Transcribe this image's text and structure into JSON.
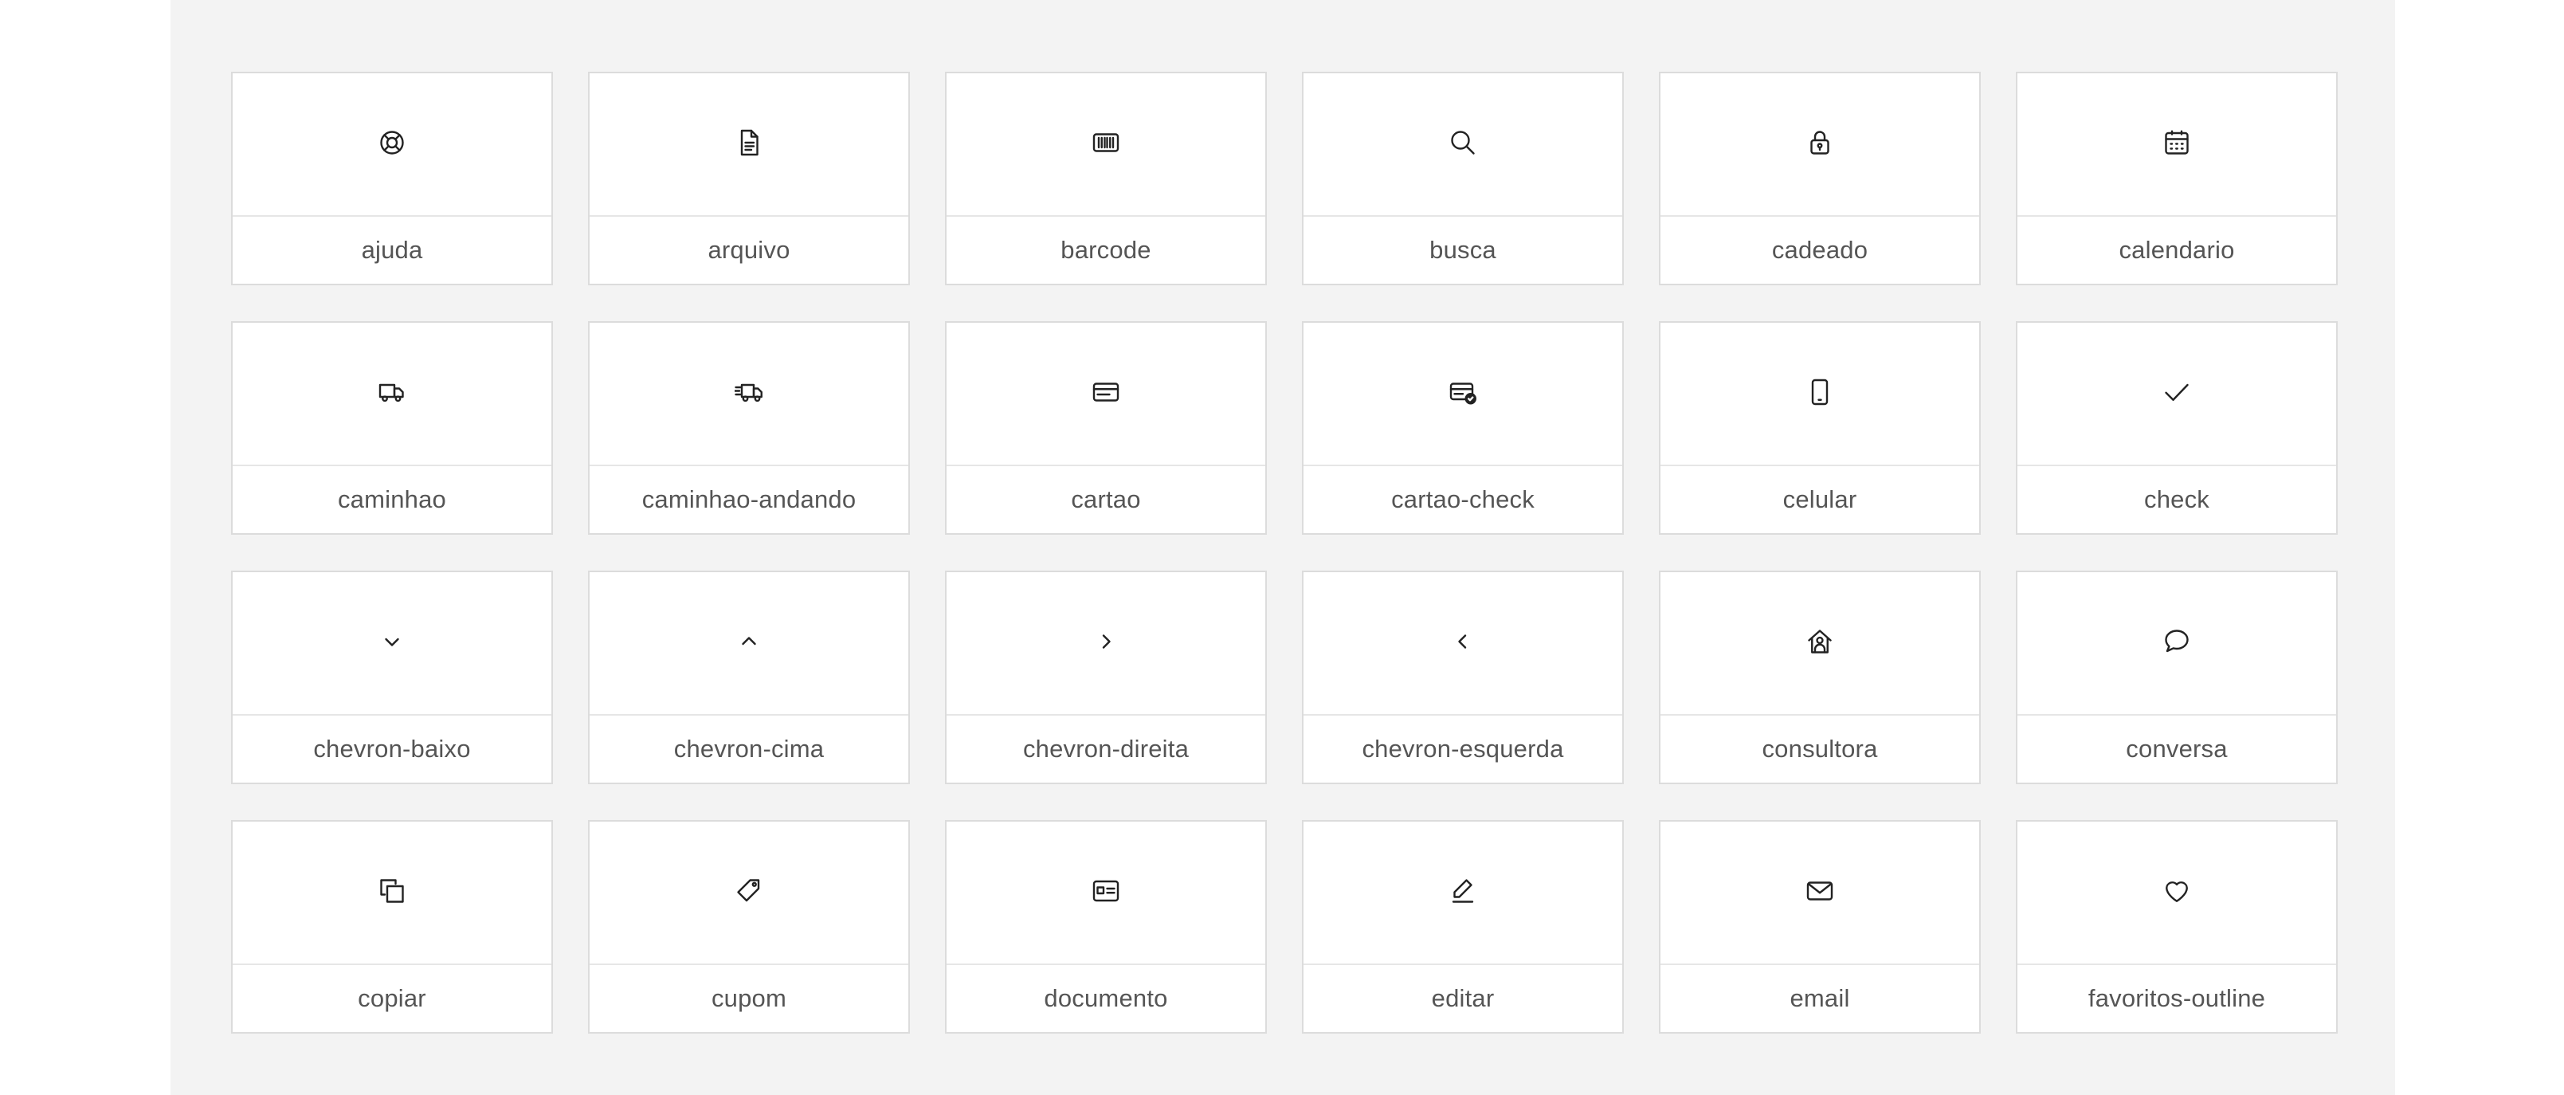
{
  "icons": [
    {
      "label": "ajuda",
      "icon": "lifebuoy-icon"
    },
    {
      "label": "arquivo",
      "icon": "file-icon"
    },
    {
      "label": "barcode",
      "icon": "barcode-icon"
    },
    {
      "label": "busca",
      "icon": "search-icon"
    },
    {
      "label": "cadeado",
      "icon": "lock-icon"
    },
    {
      "label": "calendario",
      "icon": "calendar-icon"
    },
    {
      "label": "caminhao",
      "icon": "truck-icon"
    },
    {
      "label": "caminhao-andando",
      "icon": "truck-moving-icon"
    },
    {
      "label": "cartao",
      "icon": "credit-card-icon"
    },
    {
      "label": "cartao-check",
      "icon": "credit-card-check-icon"
    },
    {
      "label": "celular",
      "icon": "smartphone-icon"
    },
    {
      "label": "check",
      "icon": "check-icon"
    },
    {
      "label": "chevron-baixo",
      "icon": "chevron-down-icon"
    },
    {
      "label": "chevron-cima",
      "icon": "chevron-up-icon"
    },
    {
      "label": "chevron-direita",
      "icon": "chevron-right-icon"
    },
    {
      "label": "chevron-esquerda",
      "icon": "chevron-left-icon"
    },
    {
      "label": "consultora",
      "icon": "house-person-icon"
    },
    {
      "label": "conversa",
      "icon": "chat-bubble-icon"
    },
    {
      "label": "copiar",
      "icon": "copy-icon"
    },
    {
      "label": "cupom",
      "icon": "tag-icon"
    },
    {
      "label": "documento",
      "icon": "id-card-icon"
    },
    {
      "label": "editar",
      "icon": "pencil-icon"
    },
    {
      "label": "email",
      "icon": "envelope-icon"
    },
    {
      "label": "favoritos-outline",
      "icon": "heart-outline-icon"
    }
  ]
}
